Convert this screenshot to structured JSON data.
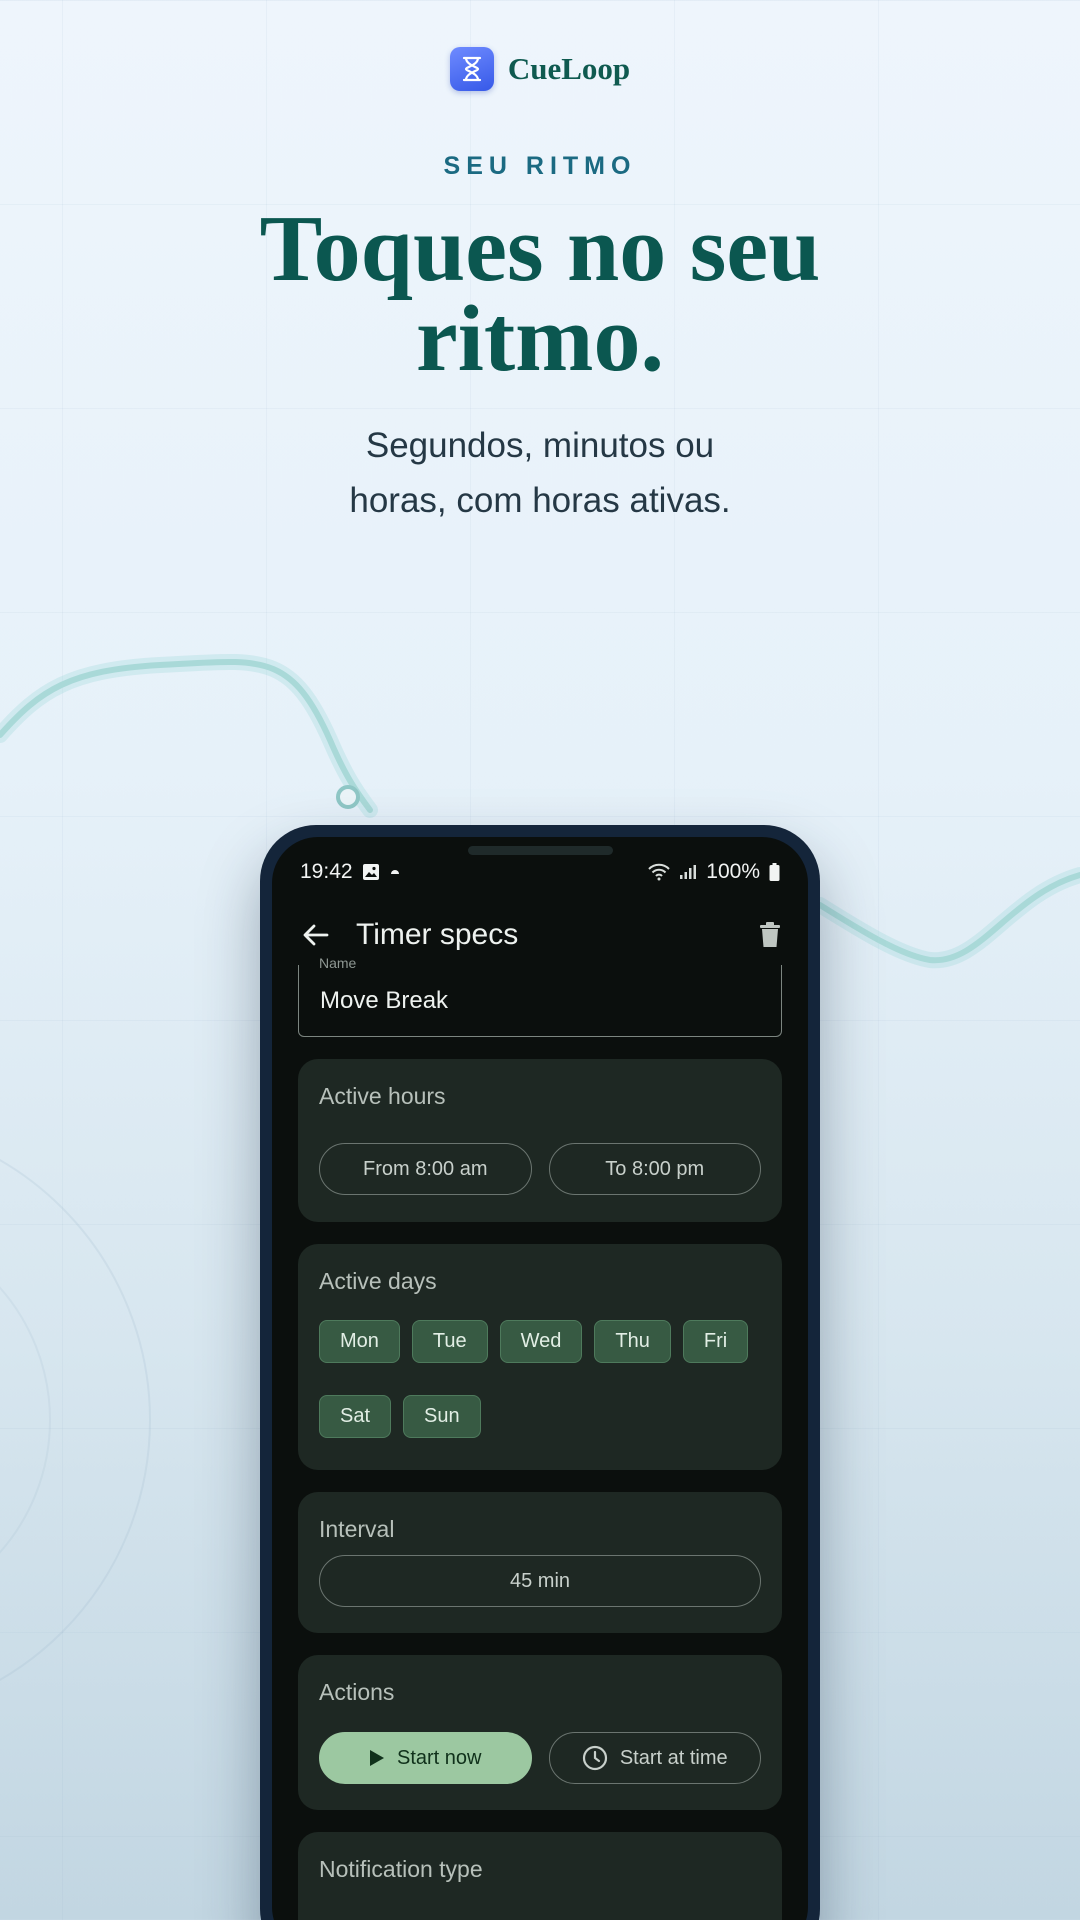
{
  "brand": {
    "name": "CueLoop",
    "icon": "hourglass-icon"
  },
  "hero": {
    "eyebrow": "SEU RITMO",
    "headline_line1": "Toques no seu",
    "headline_line2": "ritmo.",
    "subhead_line1": "Segundos, minutos ou",
    "subhead_line2": "horas, com horas ativas."
  },
  "status_bar": {
    "time": "19:42",
    "battery": "100%"
  },
  "app_bar": {
    "title": "Timer specs",
    "back_icon": "arrow-left-icon",
    "delete_icon": "trash-icon"
  },
  "name_field": {
    "label": "Name",
    "value": "Move Break"
  },
  "active_hours": {
    "title": "Active hours",
    "from": "From 8:00 am",
    "to": "To 8:00 pm"
  },
  "active_days": {
    "title": "Active days",
    "days": [
      "Mon",
      "Tue",
      "Wed",
      "Thu",
      "Fri",
      "Sat",
      "Sun"
    ]
  },
  "interval": {
    "title": "Interval",
    "value": "45 min"
  },
  "actions": {
    "title": "Actions",
    "start_now": "Start now",
    "start_at_time": "Start at time"
  },
  "notification": {
    "title": "Notification type"
  },
  "colors": {
    "accent": "#9cc8a1",
    "chip": "#375a43",
    "card": "#1e2823",
    "headline": "#0b5750"
  }
}
